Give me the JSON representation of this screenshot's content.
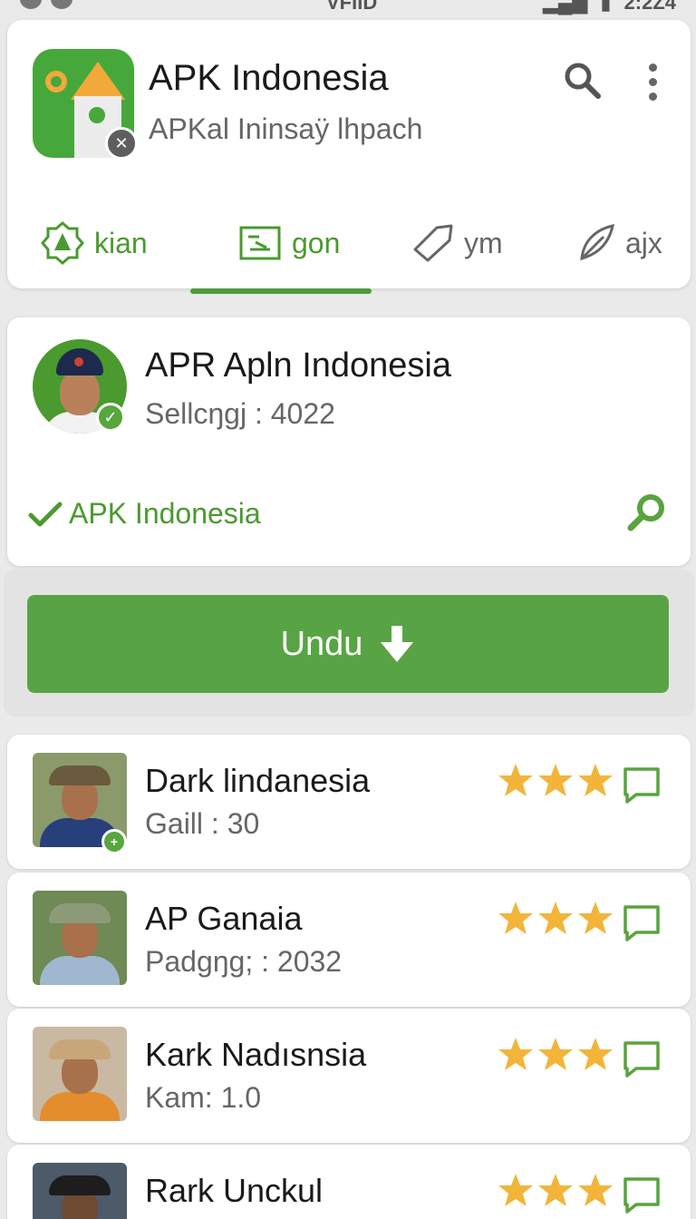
{
  "status_bar": {
    "carrier": "VFIID",
    "time": "2:2Z4"
  },
  "header": {
    "title": "APK Indonesia",
    "subtitle": "APKal Ininsaÿ lhpach",
    "tabs": [
      {
        "label": "kian",
        "icon": "gear-icon"
      },
      {
        "label": "gon",
        "icon": "folder-icon"
      },
      {
        "label": "ym",
        "icon": "tag-icon"
      },
      {
        "label": "ajx",
        "icon": "leaf-icon"
      }
    ]
  },
  "profile": {
    "name": "APR Apln Indonesia",
    "meta": "Sellcŋgj : 4022",
    "verified_label": "APK Indonesia"
  },
  "download": {
    "label": "Undu"
  },
  "list": [
    {
      "title": "Dark lindanesia",
      "meta": "Gaill : 30",
      "rating": 3
    },
    {
      "title": "AP Ganaia",
      "meta": "Padgŋg; : 2032",
      "rating": 3
    },
    {
      "title": "Kark Nadısnsia",
      "meta": "Kam: 1.0",
      "rating": 3
    },
    {
      "title": "Rark Unckul",
      "meta": "",
      "rating": 3
    }
  ],
  "colors": {
    "accent": "#58a444",
    "star": "#f2b53a",
    "muted": "#666666"
  }
}
